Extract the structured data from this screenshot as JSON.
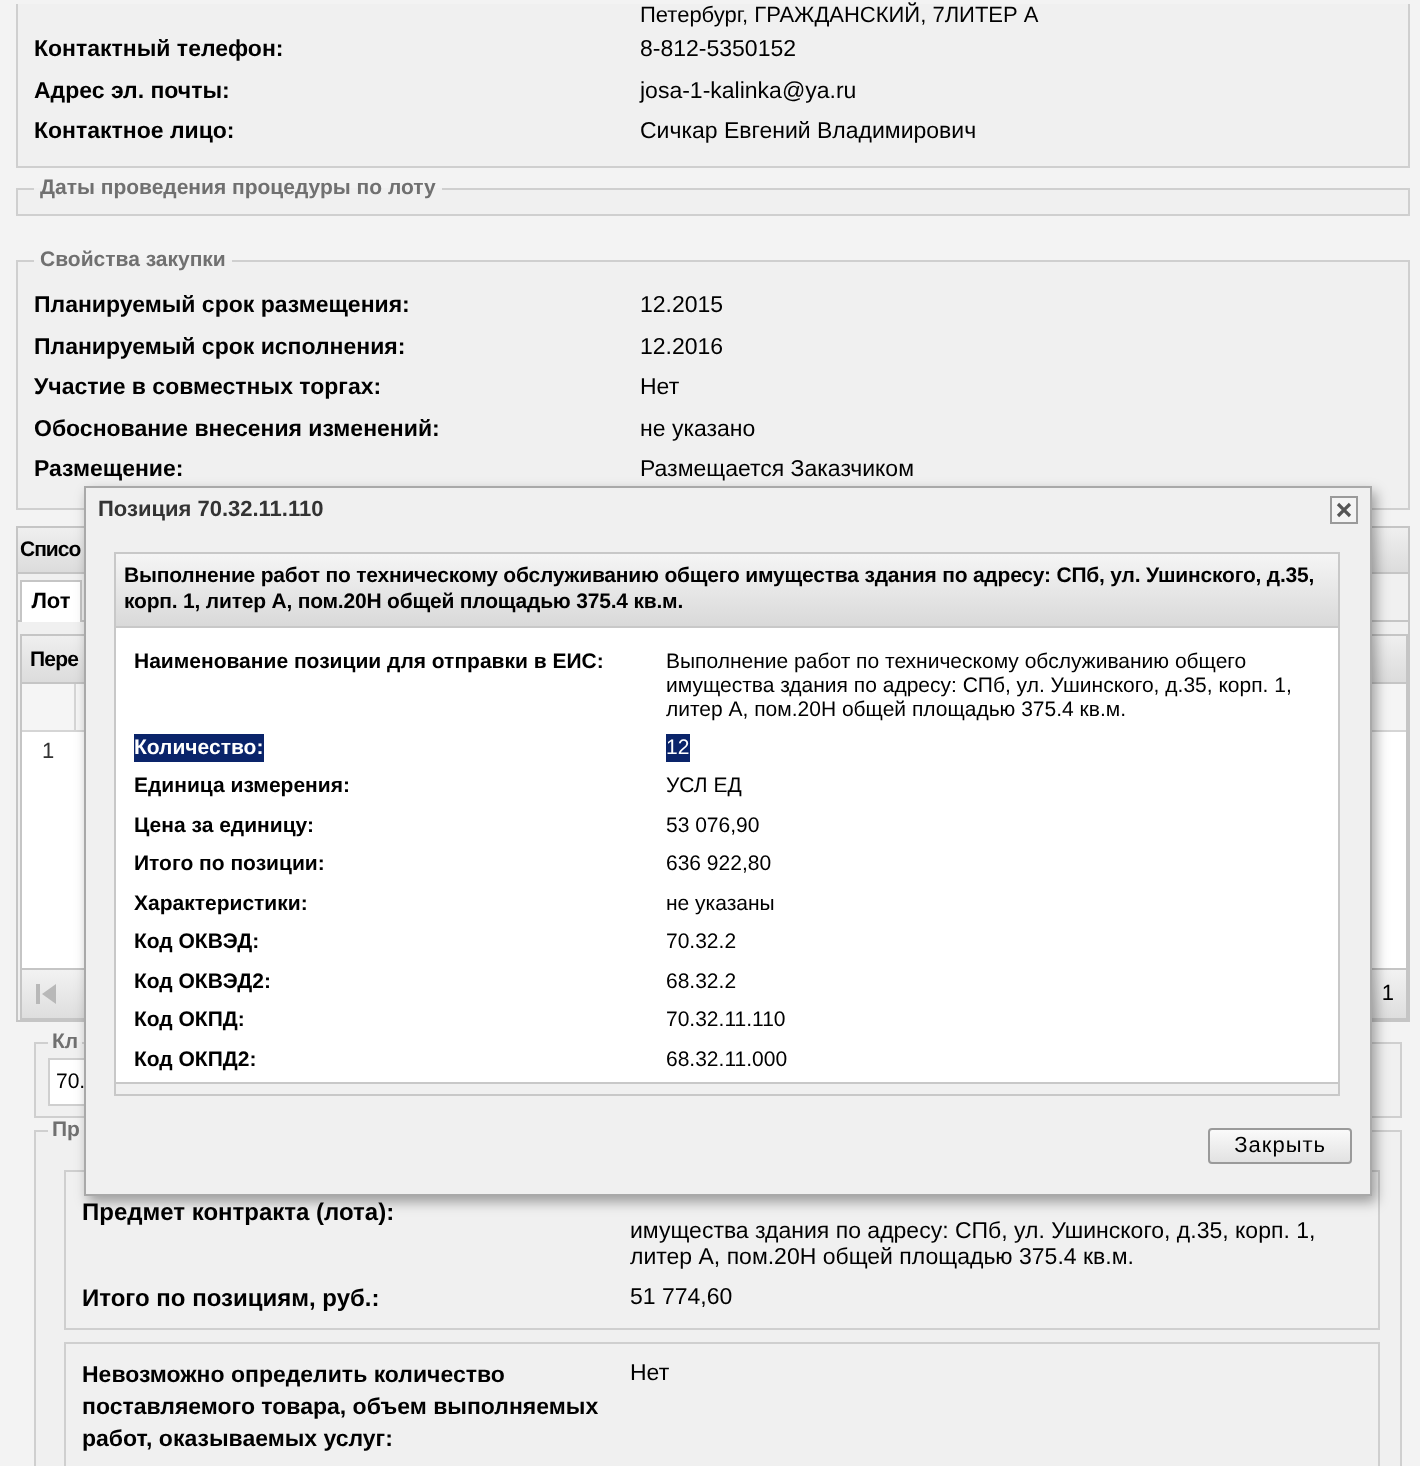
{
  "contact_panel": {
    "address_tail": "Петербург, ГРАЖДАНСКИЙ, 7ЛИТЕР А",
    "rows": [
      {
        "label": "Контактный телефон:",
        "value": "8-812-5350152"
      },
      {
        "label": "Адрес эл. почты:",
        "value": "josa-1-kalinka@ya.ru"
      },
      {
        "label": "Контактное лицо:",
        "value": "Сичкар Евгений Владимирович"
      }
    ]
  },
  "dates_section": {
    "legend": "Даты проведения процедуры по лоту"
  },
  "purchase_section": {
    "legend": "Свойства закупки",
    "rows": [
      {
        "label": "Планируемый срок размещения:",
        "value": "12.2015"
      },
      {
        "label": "Планируемый срок исполнения:",
        "value": "12.2016"
      },
      {
        "label": "Участие в совместных торгах:",
        "value": "Нет"
      },
      {
        "label": "Обоснование внесения изменений:",
        "value": "не указано"
      },
      {
        "label": "Размещение:",
        "value": "Размещается Заказчиком"
      }
    ]
  },
  "lots_panel": {
    "title": "Списо",
    "tabs": [
      {
        "label": "Лот",
        "selected": true
      }
    ],
    "grid_title": "Пере",
    "rows": [
      {
        "number": "1"
      }
    ],
    "pager_page": "1"
  },
  "classifier_section": {
    "legend": "Кл",
    "value": "70."
  },
  "subject_section": {
    "legend": "Пр",
    "rows": [
      {
        "label": "Предмет контракта (лота):",
        "value": "имущества здания по адресу: СПб, ул. Ушинского, д.35, корп. 1, литер А, пом.20Н общей площадью 375.4 кв.м."
      },
      {
        "label": "Итого по позициям, руб.:",
        "value": "51 774,60"
      }
    ],
    "extra_rows": [
      {
        "label": "Невозможно определить количество поставляемого товара, объем выполняемых работ, оказываемых услуг:",
        "value": "Нет"
      }
    ]
  },
  "dialog": {
    "title": "Позиция 70.32.11.110",
    "heading": "Выполнение работ по техническому обслуживанию общего имущества здания по адресу: СПб, ул. Ушинского, д.35, корп. 1, литер А, пом.20Н общей площадью 375.4 кв.м.",
    "rows": [
      {
        "label": "Наименование позиции для отправки в ЕИС:",
        "value": "Выполнение работ по техническому обслуживанию общего имущества здания по адресу: СПб, ул. Ушинского, д.35, корп. 1, литер А, пом.20Н общей площадью 375.4 кв.м.",
        "selected": false
      },
      {
        "label": "Количество:",
        "value": "12",
        "selected": true
      },
      {
        "label": "Единица измерения:",
        "value": "УСЛ ЕД",
        "selected": false
      },
      {
        "label": "Цена за единицу:",
        "value": "53 076,90",
        "selected": false
      },
      {
        "label": "Итого по позиции:",
        "value": "636 922,80",
        "selected": false
      },
      {
        "label": "Характеристики:",
        "value": "не указаны",
        "selected": false
      },
      {
        "label": "Код ОКВЭД:",
        "value": "70.32.2",
        "selected": false
      },
      {
        "label": "Код ОКВЭД2:",
        "value": "68.32.2",
        "selected": false
      },
      {
        "label": "Код ОКПД:",
        "value": "70.32.11.110",
        "selected": false
      },
      {
        "label": "Код ОКПД2:",
        "value": "68.32.11.000",
        "selected": false
      }
    ],
    "close_button": "Закрыть"
  }
}
